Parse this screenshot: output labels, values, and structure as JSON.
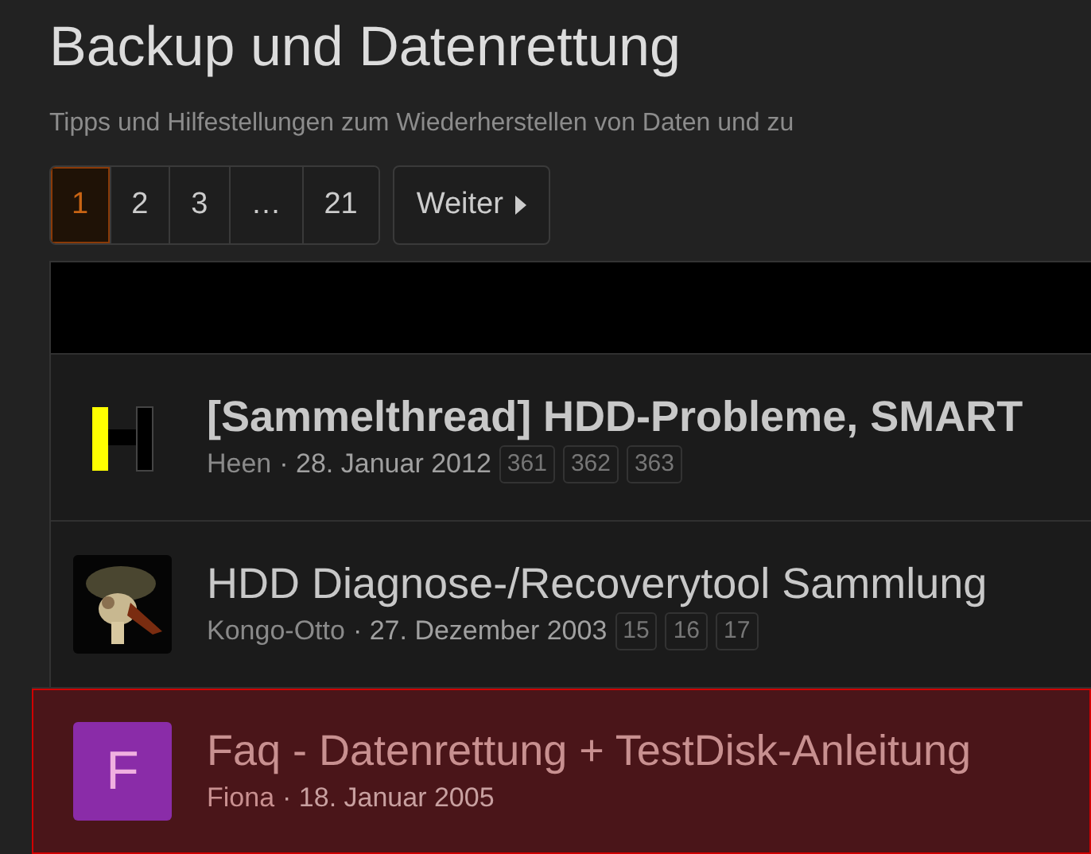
{
  "title": "Backup und Datenrettung",
  "description": "Tipps und Hilfestellungen zum Wiederherstellen von Daten und zu",
  "pagination": {
    "pages": [
      {
        "label": "1",
        "selected": true
      },
      {
        "label": "2",
        "selected": false
      },
      {
        "label": "3",
        "selected": false
      },
      {
        "label": "…",
        "selected": false
      },
      {
        "label": "21",
        "selected": false
      }
    ],
    "next": "Weiter"
  },
  "threads": [
    {
      "title": "[Sammelthread] HDD-Probleme, SMART",
      "unread": true,
      "highlighted": false,
      "avatar": {
        "kind": "logo"
      },
      "author": "Heen",
      "date": "· 28. Januar 2012",
      "pages": [
        "361",
        "362",
        "363"
      ]
    },
    {
      "title": "HDD Diagnose-/Recoverytool Sammlung",
      "unread": false,
      "highlighted": false,
      "author": "Kongo-Otto",
      "date": "· 27. Dezember 2003",
      "pages": [
        "15",
        "16",
        "17"
      ]
    },
    {
      "title": "Faq - Datenrettung + TestDisk-Anleitung",
      "unread": false,
      "highlighted": true,
      "avatar": {
        "kind": "letter",
        "letter": "F",
        "color": "#8a2ca8"
      },
      "author": "Fiona",
      "date": "· 18. Januar 2005"
    }
  ]
}
